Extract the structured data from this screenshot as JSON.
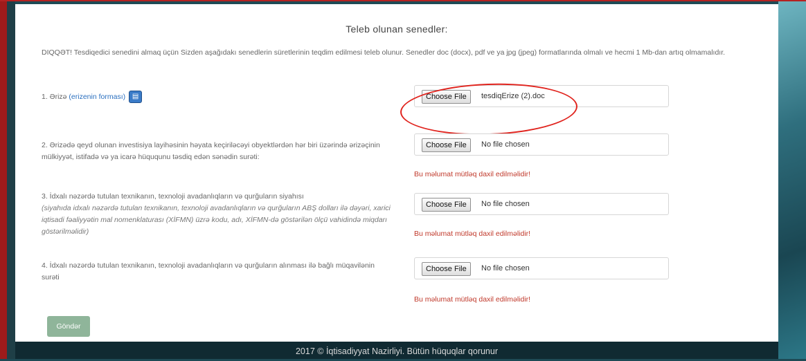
{
  "page": {
    "title": "Teleb olunan senedler:",
    "warning": "DIQQƏT! Tesdiqedici senedini almaq üçün Sizden aşağıdakı senedlerin süretlerinin teqdim edilmesi teleb olunur. Senedler doc (docx), pdf ve ya jpg (jpeg) formatlarında olmalı ve hecmi 1 Mb-dan artıq olmamalıdır."
  },
  "items": [
    {
      "label": "1. Ərizə",
      "link": "(erizenin forması)",
      "icon": "document-icon",
      "button_label": "Choose File",
      "file_name": "tesdiqErize (2).doc",
      "error": ""
    },
    {
      "label": "2. Ərizədə qeyd olunan investisiya layihəsinin həyata keçiriləcəyi obyektlərdən hər biri üzərində ərizəçinin mülkiyyət, istifadə və ya icarə hüququnu təsdiq edən sənədin surəti:",
      "button_label": "Choose File",
      "file_name": "No file chosen",
      "error": "Bu məlumat mütləq daxil edilməlidir!"
    },
    {
      "label": "3. İdxalı nəzərdə tutulan texnikanın, texnoloji avadanlıqların və qurğuların siyahısı",
      "note": "(siyahıda idxalı nəzərdə tutulan texnikanın, texnoloji avadanlıqların və qurğuların ABŞ dolları ilə dəyəri, xarici iqtisadi fəaliyyətin mal nomenklaturası (XİFMN) üzrə kodu, adı, XİFMN-də göstərilən ölçü vahidində miqdarı göstərilməlidir)",
      "button_label": "Choose File",
      "file_name": "No file chosen",
      "error": "Bu məlumat mütləq daxil edilməlidir!"
    },
    {
      "label": "4. İdxalı nəzərdə tutulan texnikanın, texnoloji avadanlıqların və qurğuların alınması ilə bağlı müqavilənin surəti",
      "button_label": "Choose File",
      "file_name": "No file chosen",
      "error": "Bu məlumat mütləq daxil edilməlidir!"
    }
  ],
  "submit_label": "Göndər",
  "footer": "2017 © İqtisadiyyat Nazirliyi. Bütün hüquqlar qorunur",
  "colors": {
    "error": "#c0392b",
    "link": "#2a6fbf",
    "submit": "#8fb59a",
    "annotation": "#e0231d"
  }
}
